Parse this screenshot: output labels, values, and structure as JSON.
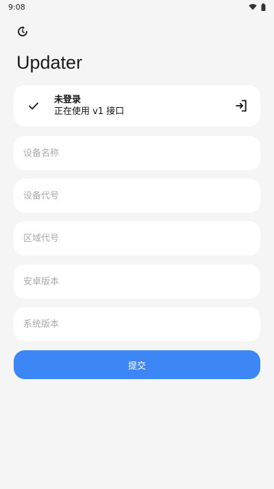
{
  "status_bar": {
    "time": "9:08",
    "icons": [
      "wifi-icon",
      "battery-icon"
    ]
  },
  "app": {
    "title": "Updater",
    "refresh_icon": "refresh-icon"
  },
  "account": {
    "status": "未登录",
    "api_text": "正在使用 v1 接口",
    "left_icon": "check-icon",
    "right_icon": "login-icon"
  },
  "form": {
    "device_name_placeholder": "设备名称",
    "device_code_placeholder": "设备代号",
    "region_code_placeholder": "区域代号",
    "android_version_placeholder": "安卓版本",
    "system_version_placeholder": "系统版本",
    "submit_label": "提交"
  },
  "colors": {
    "background": "#f5f5f5",
    "card": "#ffffff",
    "accent": "#3d86f5",
    "placeholder": "#a9a9a9"
  }
}
